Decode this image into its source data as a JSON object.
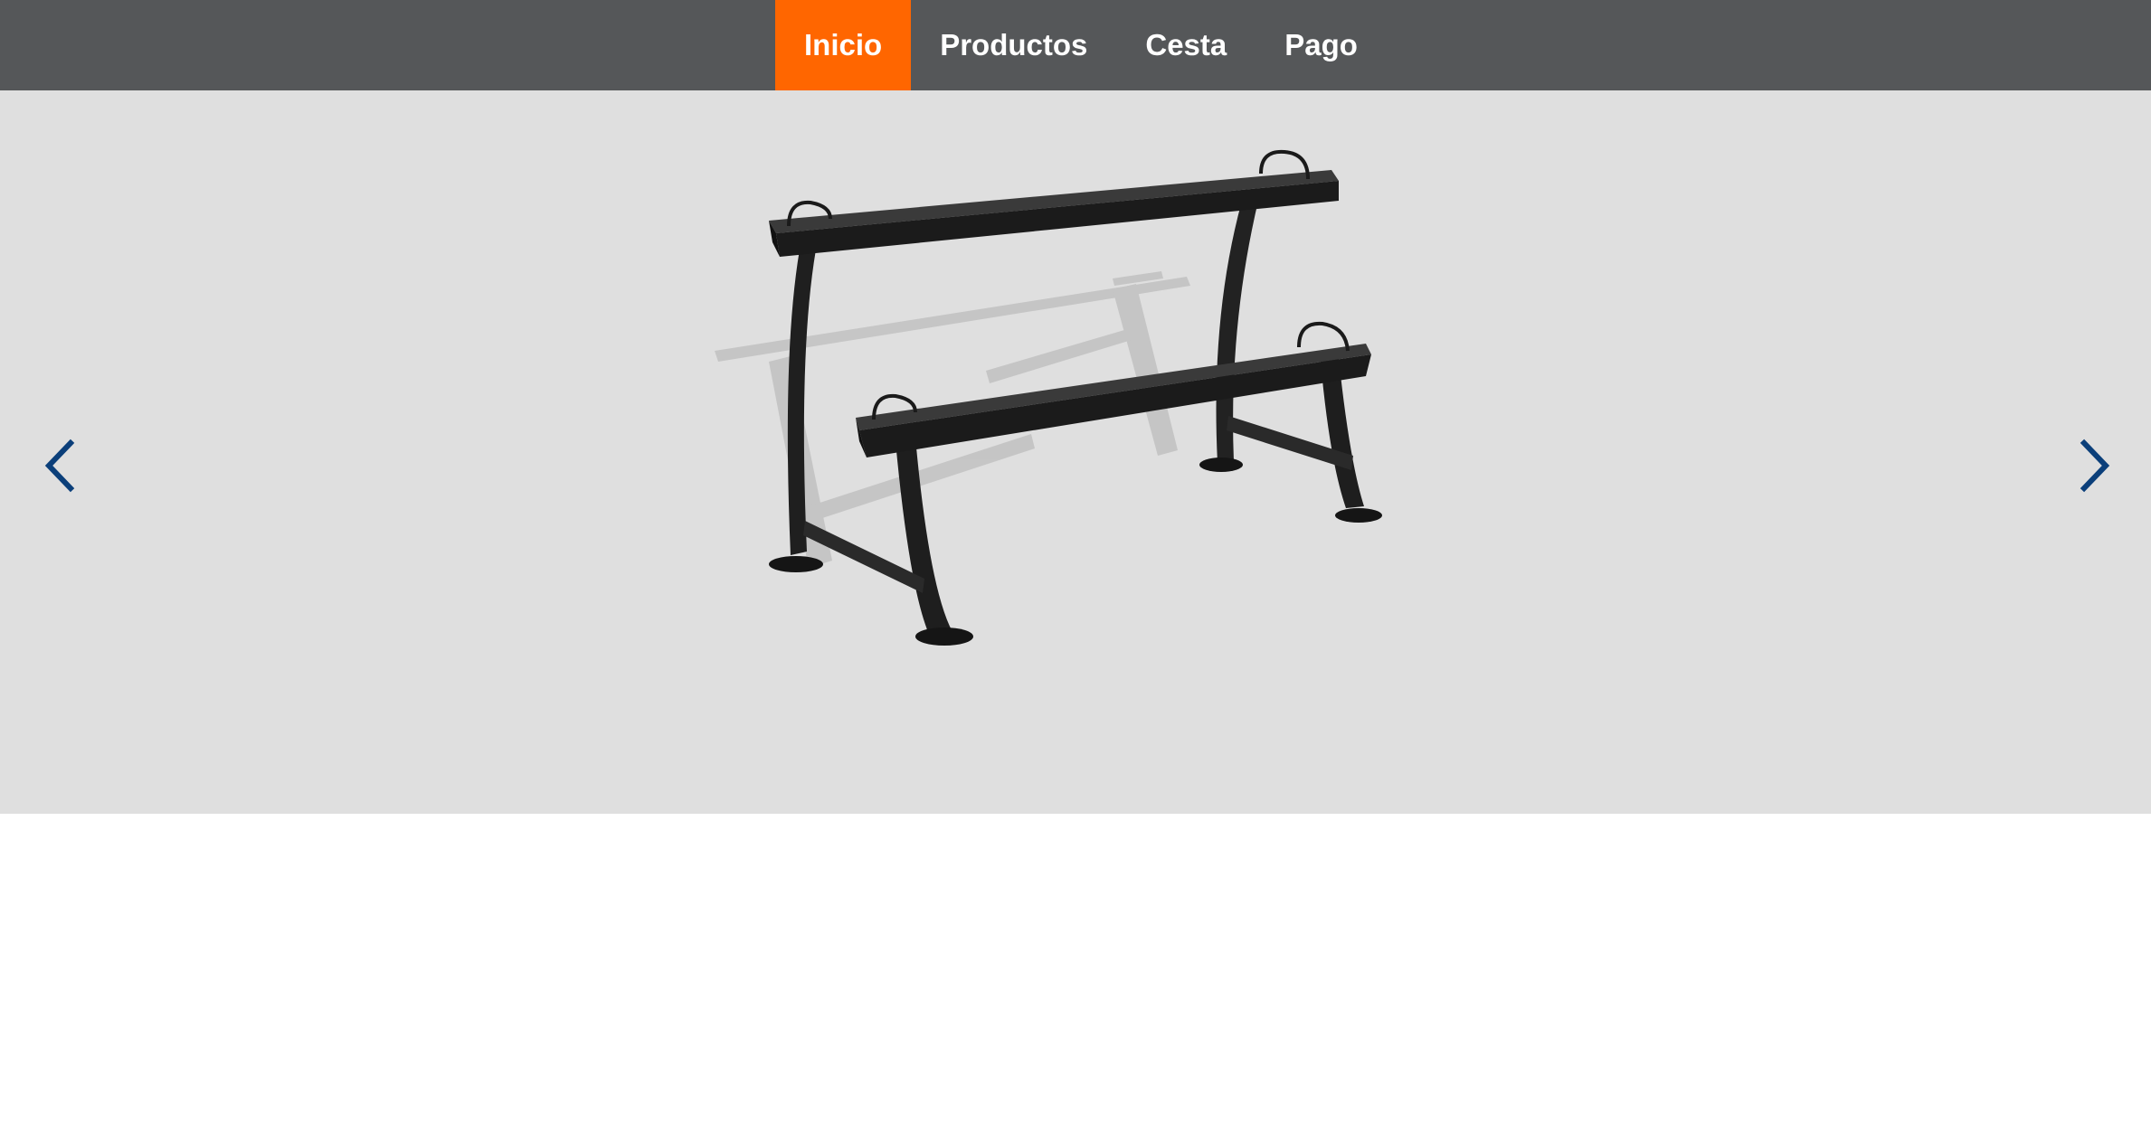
{
  "nav": {
    "items": [
      {
        "label": "Inicio",
        "active": true
      },
      {
        "label": "Productos",
        "active": false
      },
      {
        "label": "Cesta",
        "active": false
      },
      {
        "label": "Pago",
        "active": false
      }
    ]
  },
  "carousel": {
    "image": "dumbbell-rack-product-photo",
    "prev_icon": "chevron-left-icon",
    "next_icon": "chevron-right-icon"
  },
  "colors": {
    "nav_background": "#555759",
    "nav_active": "#ff6600",
    "carousel_background": "#dfdfdf",
    "arrow": "#0b3f7a"
  }
}
